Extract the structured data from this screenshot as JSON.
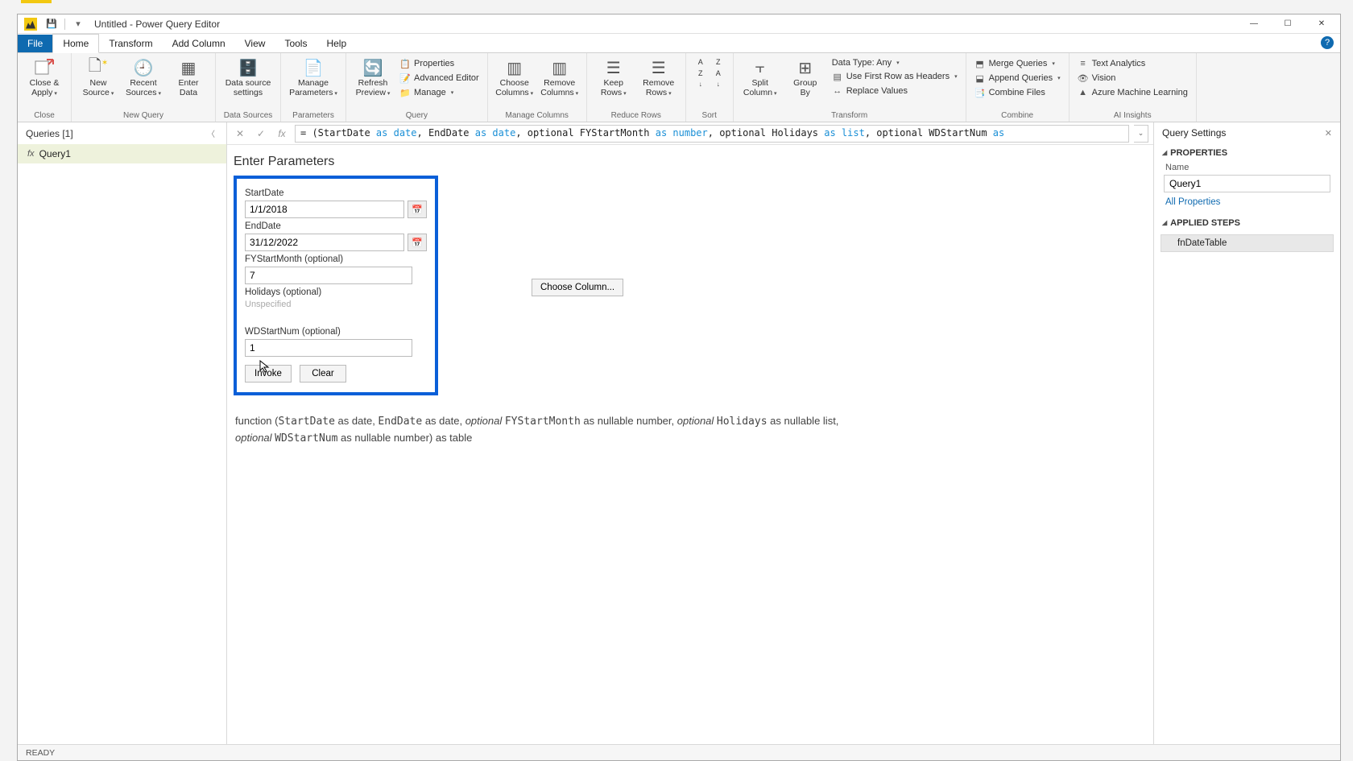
{
  "title": "Untitled - Power Query Editor",
  "ribbonTabs": {
    "file": "File",
    "home": "Home",
    "transform": "Transform",
    "addColumn": "Add Column",
    "view": "View",
    "tools": "Tools",
    "help": "Help"
  },
  "ribbon": {
    "close": {
      "closeApply": "Close &\nApply",
      "group": "Close"
    },
    "newQuery": {
      "newSource": "New\nSource",
      "recentSources": "Recent\nSources",
      "enterData": "Enter\nData",
      "group": "New Query"
    },
    "dataSources": {
      "settings": "Data source\nsettings",
      "group": "Data Sources"
    },
    "parameters": {
      "manage": "Manage\nParameters",
      "group": "Parameters"
    },
    "query": {
      "refresh": "Refresh\nPreview",
      "properties": "Properties",
      "advancedEditor": "Advanced Editor",
      "manage": "Manage",
      "group": "Query"
    },
    "manageColumns": {
      "choose": "Choose\nColumns",
      "remove": "Remove\nColumns",
      "group": "Manage Columns"
    },
    "reduceRows": {
      "keep": "Keep\nRows",
      "remove": "Remove\nRows",
      "group": "Reduce Rows"
    },
    "sort": {
      "group": "Sort"
    },
    "transform": {
      "split": "Split\nColumn",
      "groupBy": "Group\nBy",
      "dataType": "Data Type: Any",
      "firstRow": "Use First Row as Headers",
      "replace": "Replace Values",
      "group": "Transform"
    },
    "combine": {
      "merge": "Merge Queries",
      "append": "Append Queries",
      "combineFiles": "Combine Files",
      "group": "Combine"
    },
    "ai": {
      "textAnalytics": "Text Analytics",
      "vision": "Vision",
      "azureML": "Azure Machine Learning",
      "group": "AI Insights"
    }
  },
  "queriesPane": {
    "header": "Queries [1]",
    "selected": "Query1"
  },
  "formula": {
    "p1": "= (StartDate ",
    "kw1": "as date",
    "p2": ", EndDate ",
    "kw2": "as date",
    "p3": ", optional FYStartMonth ",
    "kw3": "as number",
    "p4": ", optional Holidays ",
    "kw4": "as list",
    "p5": ", optional WDStartNum ",
    "kw5": "as"
  },
  "params": {
    "title": "Enter Parameters",
    "startDate": {
      "label": "StartDate",
      "value": "1/1/2018"
    },
    "endDate": {
      "label": "EndDate",
      "value": "31/12/2022"
    },
    "fyStart": {
      "label": "FYStartMonth (optional)",
      "value": "7"
    },
    "holidays": {
      "label": "Holidays (optional)",
      "placeholder": "Unspecified",
      "chooseBtn": "Choose Column..."
    },
    "wdStart": {
      "label": "WDStartNum (optional)",
      "value": "1"
    },
    "invoke": "Invoke",
    "clear": "Clear"
  },
  "signature": {
    "t1": "function (",
    "m1": "StartDate",
    "t2": " as date, ",
    "m2": "EndDate",
    "t3": " as date, ",
    "i1": "optional ",
    "m3": "FYStartMonth",
    "t4": " as nullable number, ",
    "i2": "optional ",
    "m4": "Holidays",
    "t5": " as nullable list, ",
    "i3": "optional ",
    "m5": "WDStartNum",
    "t6": " as nullable number) as table"
  },
  "settings": {
    "header": "Query Settings",
    "properties": "PROPERTIES",
    "nameLabel": "Name",
    "nameValue": "Query1",
    "allProps": "All Properties",
    "appliedSteps": "APPLIED STEPS",
    "step1": "fnDateTable"
  },
  "status": "READY"
}
